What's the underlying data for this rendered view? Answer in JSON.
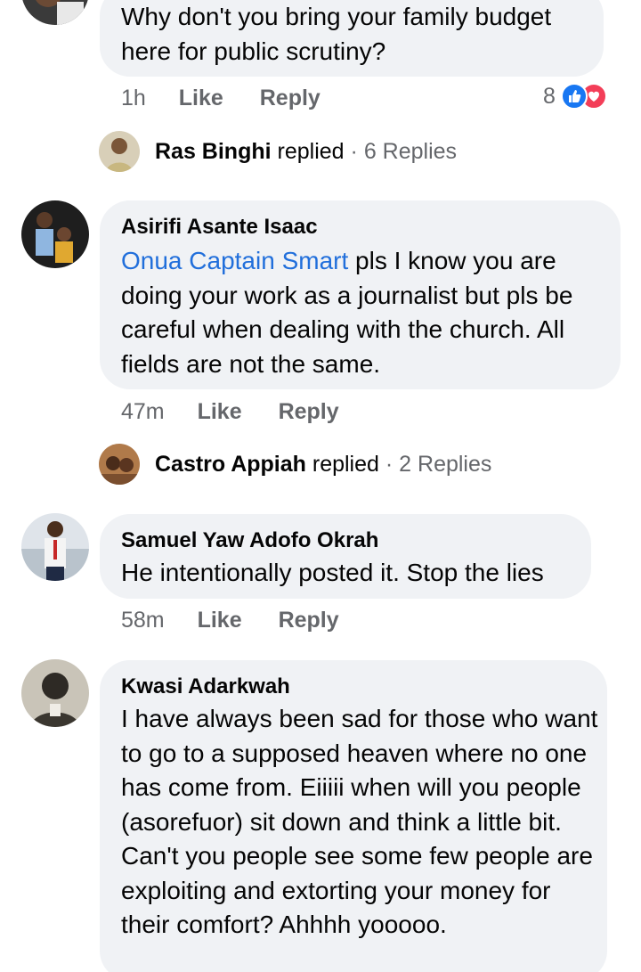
{
  "comments": [
    {
      "text": "Why don't you bring your family budget here for public scrutiny?",
      "time": "1h",
      "like": "Like",
      "reply": "Reply",
      "reaction_count": "8",
      "reaction_icons": [
        "like-icon",
        "love-icon"
      ],
      "replies": {
        "name": "Ras Binghi",
        "replied": "replied",
        "count": "· 6 Replies"
      }
    },
    {
      "author": "Asirifi Asante Isaac",
      "mention": "Onua Captain Smart",
      "text": " pls I know you are doing your work as a journalist but pls be careful when dealing with the church. All fields are not the same.",
      "time": "47m",
      "like": "Like",
      "reply": "Reply",
      "replies": {
        "name": "Castro Appiah",
        "replied": "replied",
        "count": "· 2 Replies"
      }
    },
    {
      "author": "Samuel Yaw Adofo Okrah",
      "text": "He intentionally posted it. Stop the lies",
      "time": "58m",
      "like": "Like",
      "reply": "Reply"
    },
    {
      "author": "Kwasi Adarkwah",
      "text": "I have always been sad for those who want to go to a supposed heaven where no one has come from. Eiiiii when will you people (asorefuor) sit down and think a little bit. Can't you people see some few people are exploiting and extorting your money for their comfort? Ahhhh yooooo."
    }
  ],
  "colors": {
    "bubble": "#f0f2f5",
    "mention": "#216fdb",
    "meta": "#65676b",
    "like_blue": "#1877f2",
    "love_red": "#f33e58"
  }
}
